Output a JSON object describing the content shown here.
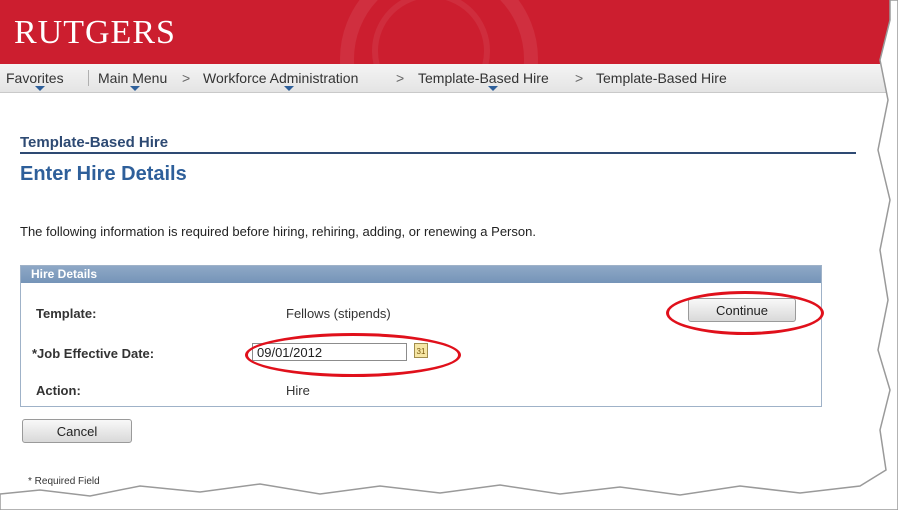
{
  "header": {
    "logo": "RUTGERS",
    "brand_color": "#cc1e2f"
  },
  "nav": {
    "favorites": "Favorites",
    "main_menu": "Main Menu",
    "workforce": "Workforce Administration",
    "template1": "Template-Based Hire",
    "template2": "Template-Based Hire",
    "separator": ">"
  },
  "page": {
    "section": "Template-Based Hire",
    "title": "Enter Hire Details",
    "info": "The following information is required before hiring, rehiring, adding, or renewing a Person."
  },
  "panel": {
    "title": "Hire Details",
    "template_label": "Template:",
    "template_value": "Fellows (stipends)",
    "date_label": "*Job Effective Date:",
    "date_value": "09/01/2012",
    "action_label": "Action:",
    "action_value": "Hire",
    "calendar_icon_text": "31"
  },
  "buttons": {
    "continue": "Continue",
    "cancel": "Cancel"
  },
  "footer": {
    "required": "* Required Field"
  },
  "colors": {
    "highlight": "#e0101b",
    "title": "#2e5f9a",
    "panel_header": "#7f9cbf"
  }
}
